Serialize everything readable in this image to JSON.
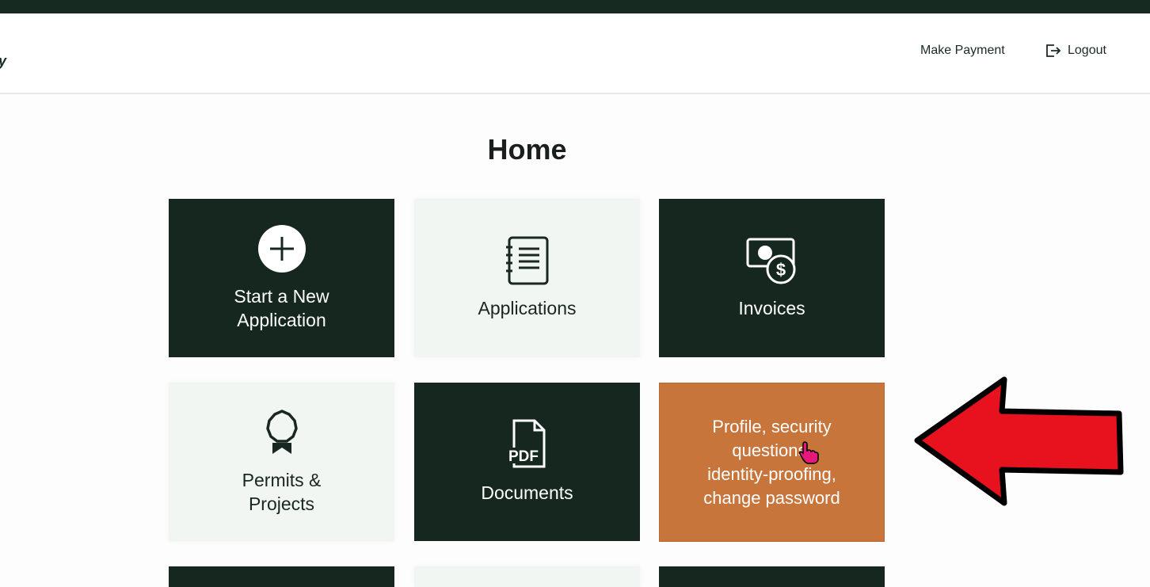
{
  "header": {
    "brand_fragment": "y",
    "make_payment": "Make Payment",
    "logout": "Logout"
  },
  "page": {
    "title": "Home"
  },
  "tiles": [
    {
      "label": "Start a New\nApplication",
      "icon": "plus-circle-icon"
    },
    {
      "label": "Applications",
      "icon": "notebook-list-icon"
    },
    {
      "label": "Invoices",
      "icon": "money-dollar-icon"
    },
    {
      "label": "Permits &\nProjects",
      "icon": "award-ribbon-icon"
    },
    {
      "label": "Documents",
      "icon": "pdf-file-icon"
    },
    {
      "label": "Profile, security\nquestions,\nidentity-proofing,\nchange password",
      "icon": "none"
    }
  ],
  "colors": {
    "dark_tile": "#15271f",
    "light_tile": "#f1f6f3",
    "highlight_tile": "#c8753b",
    "annotation_arrow": "#e8121e"
  }
}
